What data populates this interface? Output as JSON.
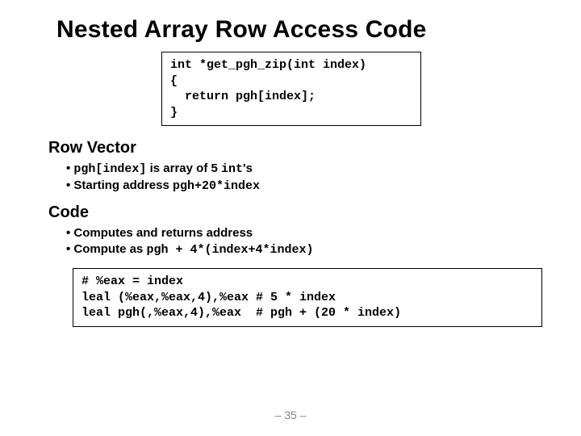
{
  "title": "Nested Array Row Access Code",
  "code_top": "int *get_pgh_zip(int index)\n{\n  return pgh[index];\n}",
  "section_row": {
    "heading": "Row Vector",
    "bullet1_a": "pgh[index]",
    "bullet1_b": " is array of 5 ",
    "bullet1_c": "int",
    "bullet1_d": "'s",
    "bullet2_a": "Starting address ",
    "bullet2_b": "pgh+20*index"
  },
  "section_code": {
    "heading": "Code",
    "bullet1": "Computes and returns address",
    "bullet2_a": "Compute as ",
    "bullet2_b": "pgh + 4*(index+4*index)"
  },
  "code_bottom": "# %eax = index\nleal (%eax,%eax,4),%eax # 5 * index\nleal pgh(,%eax,4),%eax  # pgh + (20 * index)",
  "page_number": "– 35 –"
}
